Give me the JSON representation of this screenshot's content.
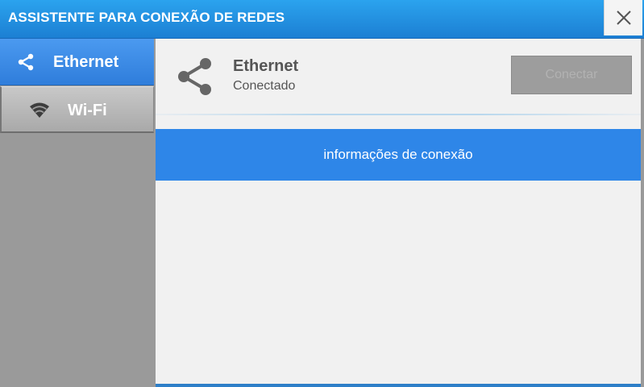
{
  "window": {
    "title": "ASSISTENTE PARA CONEXÃO DE REDES",
    "close_icon": "close-icon"
  },
  "sidebar": {
    "items": [
      {
        "label": "Ethernet",
        "icon": "share-icon",
        "active": true
      },
      {
        "label": "Wi-Fi",
        "icon": "wifi-icon",
        "active": false
      }
    ]
  },
  "connection": {
    "icon": "share-icon",
    "name": "Ethernet",
    "status": "Conectado",
    "connect_label": "Conectar"
  },
  "info": {
    "label": "informações de conexão"
  },
  "colors": {
    "titlebar": "#1c7fd3",
    "active_tab": "#2f7ddb",
    "info_bar": "#2e86e8",
    "sidebar_bg": "#9a9a9a",
    "panel_bg": "#f1f1f1"
  }
}
